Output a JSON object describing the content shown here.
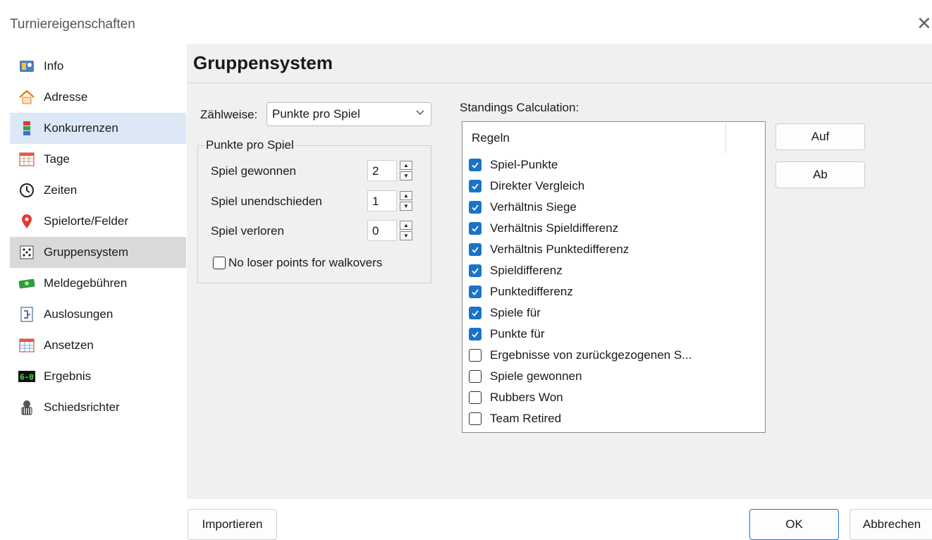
{
  "window": {
    "title": "Turniereigenschaften"
  },
  "sidebar": {
    "items": [
      {
        "label": "Info",
        "icon": "info-icon"
      },
      {
        "label": "Adresse",
        "icon": "home-icon"
      },
      {
        "label": "Konkurrenzen",
        "icon": "events-icon"
      },
      {
        "label": "Tage",
        "icon": "calendar-grid-icon"
      },
      {
        "label": "Zeiten",
        "icon": "clock-icon"
      },
      {
        "label": "Spielorte/Felder",
        "icon": "location-pin-icon"
      },
      {
        "label": "Gruppensystem",
        "icon": "group-grid-icon"
      },
      {
        "label": "Meldegebühren",
        "icon": "money-icon"
      },
      {
        "label": "Auslosungen",
        "icon": "draw-icon"
      },
      {
        "label": "Ansetzen",
        "icon": "schedule-icon"
      },
      {
        "label": "Ergebnis",
        "icon": "score-icon"
      },
      {
        "label": "Schiedsrichter",
        "icon": "referee-icon"
      }
    ]
  },
  "main": {
    "title": "Gruppensystem",
    "counting": {
      "label": "Zählweise:",
      "value": "Punkte pro Spiel"
    },
    "points_group": {
      "legend": "Punkte pro Spiel",
      "rows": [
        {
          "label": "Spiel gewonnen",
          "value": "2"
        },
        {
          "label": "Spiel unendschieden",
          "value": "1"
        },
        {
          "label": "Spiel verloren",
          "value": "0"
        }
      ],
      "walkover_label": "No loser points for walkovers"
    },
    "standings": {
      "label": "Standings Calculation:",
      "column_header": "Regeln",
      "rules": [
        {
          "label": "Spiel-Punkte",
          "checked": true
        },
        {
          "label": "Direkter Vergleich",
          "checked": true
        },
        {
          "label": "Verhältnis Siege",
          "checked": true
        },
        {
          "label": "Verhältnis Spieldifferenz",
          "checked": true
        },
        {
          "label": "Verhältnis Punktedifferenz",
          "checked": true
        },
        {
          "label": "Spieldifferenz",
          "checked": true
        },
        {
          "label": "Punktedifferenz",
          "checked": true
        },
        {
          "label": "Spiele für",
          "checked": true
        },
        {
          "label": "Punkte für",
          "checked": true
        },
        {
          "label": "Ergebnisse von zurückgezogenen S...",
          "checked": false
        },
        {
          "label": "Spiele gewonnen",
          "checked": false
        },
        {
          "label": "Rubbers Won",
          "checked": false
        },
        {
          "label": "Team Retired",
          "checked": false
        }
      ]
    },
    "buttons": {
      "up": "Auf",
      "down": "Ab"
    }
  },
  "footer": {
    "import": "Importieren",
    "ok": "OK",
    "cancel": "Abbrechen"
  },
  "colors": {
    "accent": "#1a73c9",
    "selected_bg": "#d9d9d9",
    "hover_bg": "#dce8f5"
  }
}
